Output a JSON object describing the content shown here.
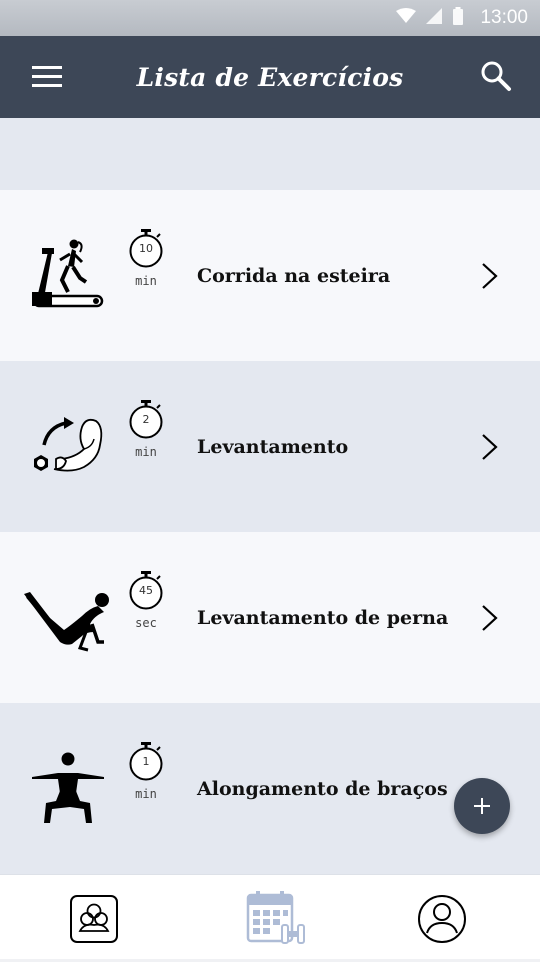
{
  "status_bar": {
    "time": "13:00"
  },
  "app_bar": {
    "title": "Lista de Exercícios",
    "menu_icon": "hamburger-menu-icon",
    "search_icon": "search-icon"
  },
  "exercises": [
    {
      "name": "Corrida na esteira",
      "timer_value": "10",
      "timer_unit": "min",
      "illustration": "treadmill-runner"
    },
    {
      "name": "Levantamento",
      "timer_value": "2",
      "timer_unit": "min",
      "illustration": "bicep-curl"
    },
    {
      "name": "Levantamento de perna",
      "timer_value": "45",
      "timer_unit": "sec",
      "illustration": "leg-raise"
    },
    {
      "name": "Alongamento de braços",
      "timer_value": "1",
      "timer_unit": "min",
      "illustration": "arm-stretch"
    }
  ],
  "fab": {
    "icon": "plus-icon"
  },
  "bottom_nav": {
    "items": [
      {
        "icon": "groups-icon"
      },
      {
        "icon": "calendar-workout-icon"
      },
      {
        "icon": "profile-icon"
      }
    ]
  },
  "colors": {
    "primary": "#3d4757",
    "row_light": "#f7f8fb",
    "row_dark": "#e4e8f0",
    "calendar_accent": "#aebcd6"
  }
}
